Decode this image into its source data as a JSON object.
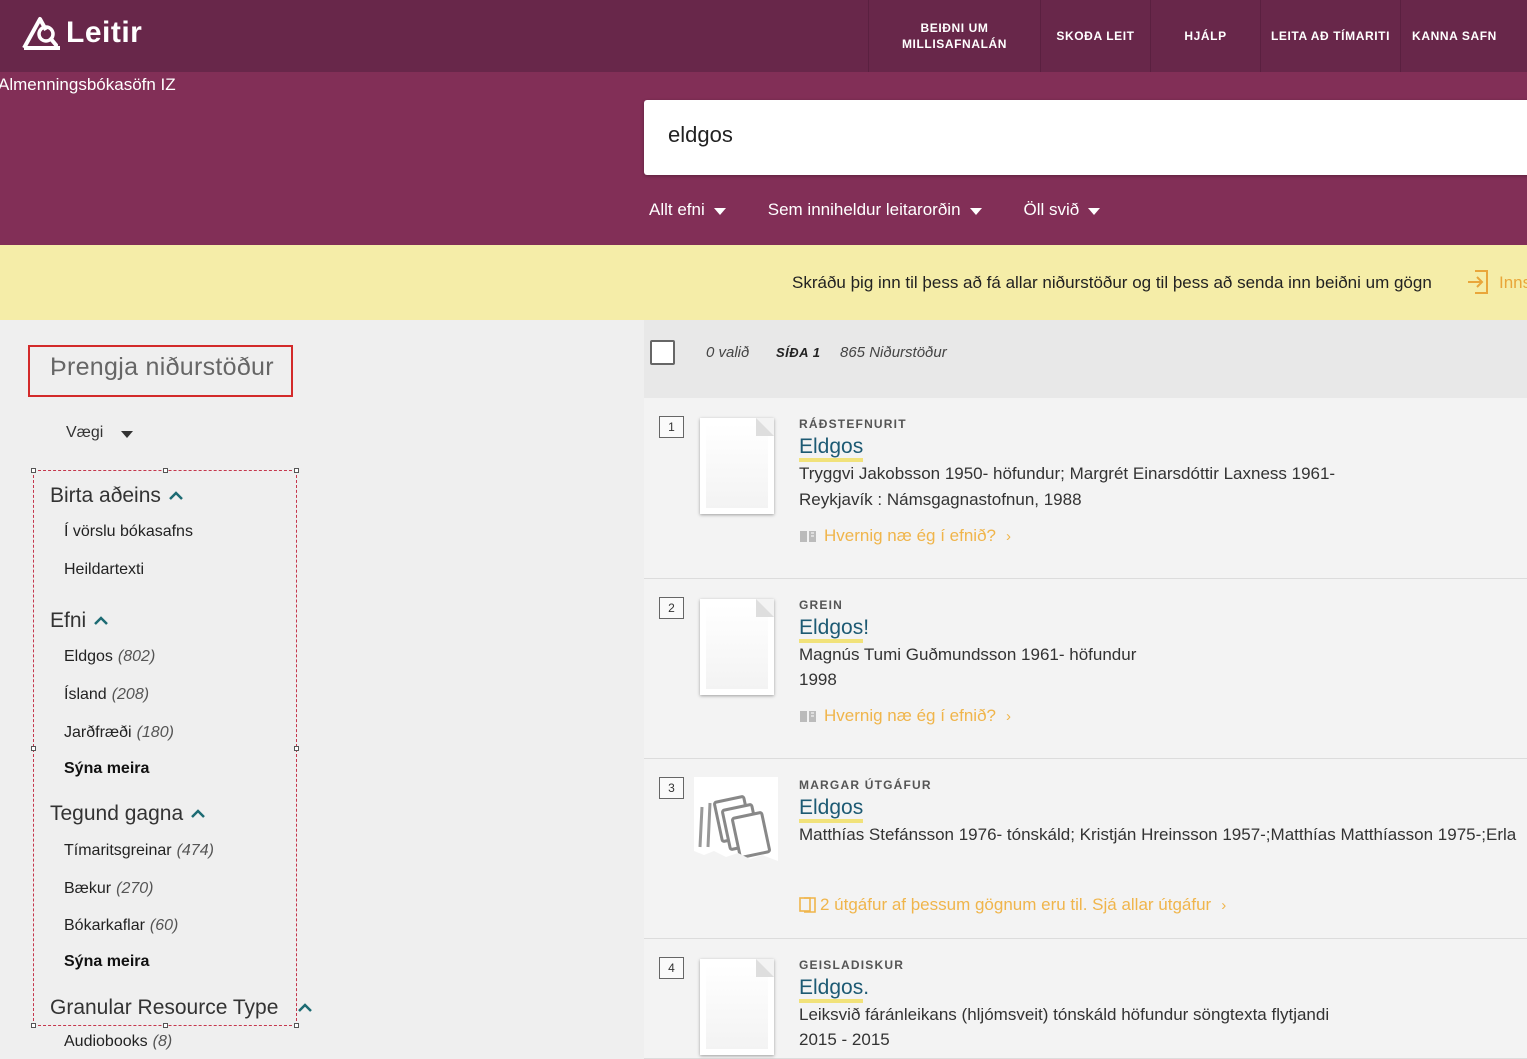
{
  "header": {
    "logo_text": "Leitir",
    "nav": [
      {
        "line1": "BEIÐNI UM",
        "line2": "MILLISAFNALÁN",
        "width": 172
      },
      {
        "line1": "SKOÐA LEIT",
        "line2": "",
        "width": 110
      },
      {
        "line1": "HJÁLP",
        "line2": "",
        "width": 110
      },
      {
        "line1": "LEITA AÐ TÍMARITI",
        "line2": "",
        "width": 140
      },
      {
        "line1": "KANNA SAFN",
        "line2": "",
        "width": 108
      }
    ]
  },
  "search": {
    "library_name": "Almenningsbókasöfn IZ",
    "query": "eldgos",
    "filters": [
      "Allt efni",
      "Sem inniheldur leitarorðin",
      "Öll svið"
    ]
  },
  "banner": {
    "text": "Skráðu þig inn til þess að fá allar niðurstöður og til þess að senda inn beiðni um gögn",
    "login_label": "Innskrá"
  },
  "facets": {
    "title": "Þrengja niðurstöður",
    "sort_label": "Vægi",
    "groups": {
      "show_only": {
        "title": "Birta aðeins",
        "items": [
          "Í vörslu bókasafns",
          "Heildartexti"
        ]
      },
      "subject": {
        "title": "Efni",
        "items": [
          {
            "label": "Eldgos",
            "count": "(802)"
          },
          {
            "label": "Ísland",
            "count": "(208)"
          },
          {
            "label": "Jarðfræði",
            "count": "(180)"
          }
        ],
        "more": "Sýna meira"
      },
      "type": {
        "title": "Tegund gagna",
        "items": [
          {
            "label": "Tímaritsgreinar",
            "count": "(474)"
          },
          {
            "label": "Bækur",
            "count": "(270)"
          },
          {
            "label": "Bókarkaflar",
            "count": "(60)"
          }
        ],
        "more": "Sýna meira"
      },
      "granular": {
        "title": "Granular Resource Type",
        "items": [
          {
            "label": "Audiobooks",
            "count": "(8)"
          }
        ]
      }
    }
  },
  "results_header": {
    "selected": "0 valið",
    "page": "SÍÐA 1",
    "total": "865 Niðurstöður"
  },
  "results": [
    {
      "num": "1",
      "type": "RÁÐSTEFNURIT",
      "title": "Eldgos",
      "title_suffix": "",
      "lines": [
        "Tryggvi Jakobsson 1950- höfundur; Margrét Einarsdóttir Laxness 1961-",
        "Reykjavík : Námsgagnastofnun, 1988"
      ],
      "link": "Hvernig næ ég í efnið?"
    },
    {
      "num": "2",
      "type": "GREIN",
      "title": "Eldgos",
      "title_suffix": "!",
      "lines": [
        "Magnús Tumi Guðmundsson 1961- höfundur",
        "1998"
      ],
      "link": "Hvernig næ ég í efnið?"
    },
    {
      "num": "3",
      "type": "MARGAR ÚTGÁFUR",
      "title": "Eldgos",
      "title_suffix": "",
      "lines": [
        "Matthías Stefánsson 1976- tónskáld; Kristján Hreinsson 1957-;Matthías Matthíasson 1975-;Erla"
      ],
      "link": "2 útgáfur af þessum gögnum eru til. Sjá allar útgáfur"
    },
    {
      "num": "4",
      "type": "GEISLADISKUR",
      "title": "Eldgos",
      "title_suffix": ".",
      "lines": [
        "Leiksvið fáránleikans (hljómsveit) tónskáld höfundur söngtexta flytjandi",
        "2015 - 2015"
      ],
      "link": ""
    }
  ],
  "colors": {
    "topbar": "#68274a",
    "searchband": "#822f57",
    "banner": "#f5eda8",
    "link_orange": "#f0b54b",
    "title_blue": "#1d5a73"
  }
}
